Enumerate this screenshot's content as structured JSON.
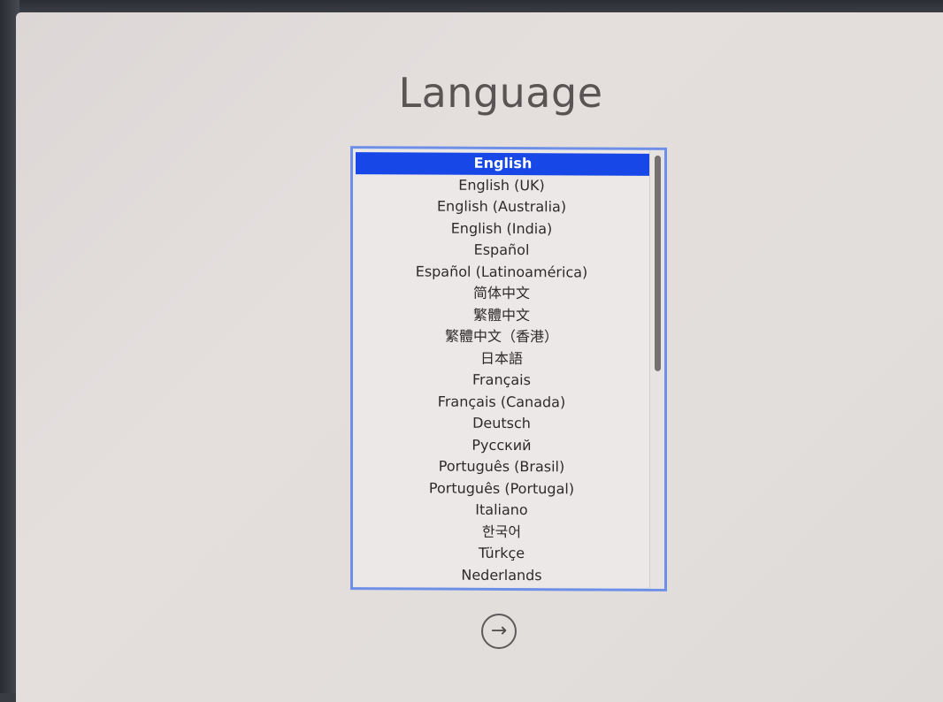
{
  "title": "Language",
  "languages": [
    {
      "label": "English",
      "selected": true
    },
    {
      "label": "English (UK)"
    },
    {
      "label": "English (Australia)"
    },
    {
      "label": "English (India)"
    },
    {
      "label": "Español"
    },
    {
      "label": "Español (Latinoamérica)"
    },
    {
      "label": "简体中文"
    },
    {
      "label": "繁體中文"
    },
    {
      "label": "繁體中文（香港）"
    },
    {
      "label": "日本語"
    },
    {
      "label": "Français"
    },
    {
      "label": "Français (Canada)"
    },
    {
      "label": "Deutsch"
    },
    {
      "label": "Русский"
    },
    {
      "label": "Português (Brasil)"
    },
    {
      "label": "Português (Portugal)"
    },
    {
      "label": "Italiano"
    },
    {
      "label": "한국어"
    },
    {
      "label": "Türkçe"
    },
    {
      "label": "Nederlands"
    }
  ],
  "next_button": {
    "icon": "arrow-right-icon",
    "glyph": "→"
  },
  "colors": {
    "selection": "#1747e6",
    "focus_ring": "#6e8fe8",
    "background": "#e2dedc"
  }
}
